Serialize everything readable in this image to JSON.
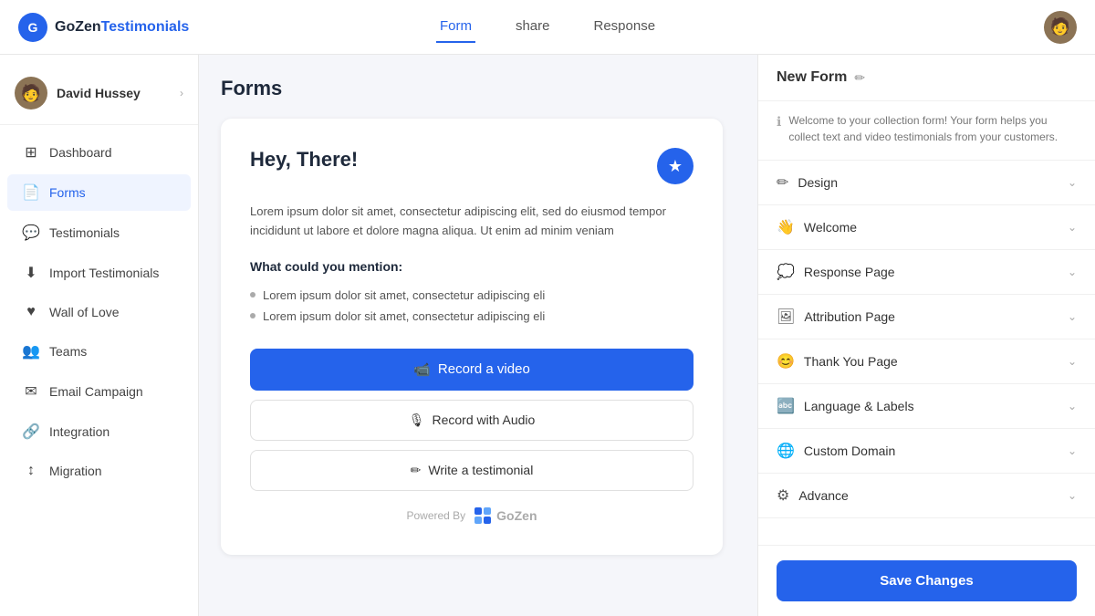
{
  "app": {
    "logo_gozen": "GoZen",
    "logo_testimonials": "Testimonials"
  },
  "topnav": {
    "tabs": [
      {
        "label": "Form",
        "active": true
      },
      {
        "label": "share",
        "active": false
      },
      {
        "label": "Response",
        "active": false
      }
    ]
  },
  "sidebar": {
    "user": {
      "name": "David Hussey"
    },
    "items": [
      {
        "label": "Dashboard",
        "icon": "⊞",
        "active": false
      },
      {
        "label": "Forms",
        "icon": "📄",
        "active": true
      },
      {
        "label": "Testimonials",
        "icon": "💬",
        "active": false
      },
      {
        "label": "Import Testimonials",
        "icon": "⬇",
        "active": false
      },
      {
        "label": "Wall of Love",
        "icon": "♥",
        "active": false
      },
      {
        "label": "Teams",
        "icon": "👥",
        "active": false
      },
      {
        "label": "Email Campaign",
        "icon": "✉",
        "active": false
      },
      {
        "label": "Integration",
        "icon": "🔗",
        "active": false
      },
      {
        "label": "Migration",
        "icon": "↕",
        "active": false
      }
    ]
  },
  "main": {
    "page_title": "Forms",
    "form_preview": {
      "greeting": "Hey, There!",
      "description": "Lorem ipsum dolor sit amet, consectetur adipiscing elit, sed do eiusmod tempor incididunt ut labore et dolore magna aliqua. Ut enim ad minim veniam",
      "mention_title": "What could you mention:",
      "mention_items": [
        "Lorem ipsum dolor sit amet, consectetur adipiscing eli",
        "Lorem ipsum dolor sit amet, consectetur adipiscing eli"
      ],
      "btn_video": "Record a video",
      "btn_audio": "Record with Audio",
      "btn_write": "Write a testimonial",
      "powered_by": "Powered By",
      "gozen_brand": "GoZen"
    }
  },
  "right_panel": {
    "title": "New Form",
    "info_text": "Welcome to your collection form! Your form helps you collect text and video testimonials from your customers.",
    "accordion_items": [
      {
        "label": "Design",
        "icon": "✏"
      },
      {
        "label": "Welcome",
        "icon": "👋"
      },
      {
        "label": "Response Page",
        "icon": "💭"
      },
      {
        "label": "Attribution Page",
        "icon": "🖼"
      },
      {
        "label": "Thank You Page",
        "icon": "😊"
      },
      {
        "label": "Language & Labels",
        "icon": "🔤"
      },
      {
        "label": "Custom Domain",
        "icon": "🌐"
      },
      {
        "label": "Advance",
        "icon": "⚙"
      }
    ],
    "save_btn_label": "Save Changes"
  }
}
